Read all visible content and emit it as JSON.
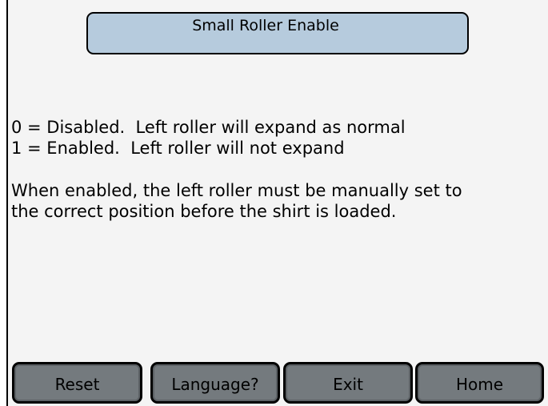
{
  "header": {
    "title": "Small Roller Enable"
  },
  "description": {
    "line_0": "0 = Disabled.  Left roller will expand as normal",
    "line_1": "1 = Enabled.  Left roller will not expand"
  },
  "note": {
    "line_0": "When enabled, the left roller must be manually set to",
    "line_1": "the correct position before the shirt is loaded."
  },
  "buttons": {
    "reset": "Reset",
    "language": "Language?",
    "exit": "Exit",
    "home": "Home"
  },
  "colors": {
    "title_background": "#b6cbdd",
    "button_background": "#747a7e",
    "screen_background": "#f4f4f4"
  }
}
